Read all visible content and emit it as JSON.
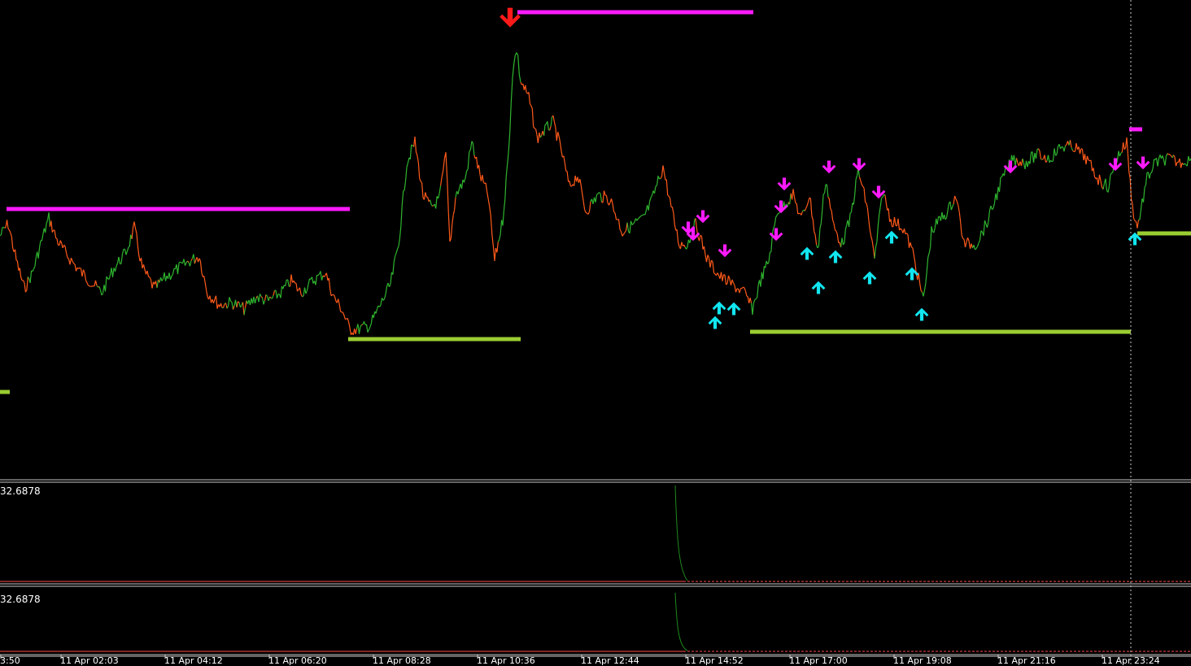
{
  "colors": {
    "background": "#000000",
    "up_series": "#2fb52f",
    "down_series": "#ff5a1a",
    "resistance": "#ff1aff",
    "support": "#9acd32",
    "sell_arrow": "#ff1aff",
    "buy_arrow": "#11e6f0",
    "major_sell_arrow": "#ff1a1a",
    "separator": "#c8c8c8",
    "indicator_line": "#1e8a1e",
    "indicator_level": "#ff4d4d",
    "crosshair": "#cccccc"
  },
  "panes": {
    "indicator1_value": "32.6878",
    "indicator2_value": "32.6878"
  },
  "x_axis": {
    "ticks": [
      "3:50",
      "11 Apr 02:03",
      "11 Apr 04:12",
      "11 Apr 06:20",
      "11 Apr 08:28",
      "11 Apr 10:36",
      "11 Apr 12:44",
      "11 Apr 14:52",
      "11 Apr 17:00",
      "11 Apr 19:08",
      "11 Apr 21:16",
      "11 Apr 23:24"
    ]
  },
  "chart_data": {
    "type": "line",
    "title": "",
    "x_unit": "minutes from first tick (11 Apr 00:00 approx)",
    "series": [
      {
        "name": "",
        "points": [
          [
            0,
            290
          ],
          [
            10,
            275
          ],
          [
            20,
            320
          ],
          [
            30,
            355
          ],
          [
            40,
            335
          ],
          [
            50,
            300
          ],
          [
            60,
            268
          ],
          [
            70,
            295
          ],
          [
            80,
            310
          ],
          [
            95,
            330
          ],
          [
            110,
            345
          ],
          [
            125,
            360
          ],
          [
            140,
            330
          ],
          [
            155,
            310
          ],
          [
            165,
            280
          ],
          [
            175,
            330
          ],
          [
            190,
            355
          ],
          [
            205,
            340
          ],
          [
            220,
            330
          ],
          [
            235,
            320
          ],
          [
            245,
            315
          ],
          [
            255,
            360
          ],
          [
            270,
            375
          ],
          [
            285,
            372
          ],
          [
            300,
            380
          ],
          [
            315,
            365
          ],
          [
            330,
            370
          ],
          [
            345,
            360
          ],
          [
            358,
            345
          ],
          [
            370,
            360
          ],
          [
            385,
            345
          ],
          [
            400,
            335
          ],
          [
            410,
            365
          ],
          [
            420,
            380
          ],
          [
            430,
            405
          ],
          [
            440,
            405
          ],
          [
            455,
            400
          ],
          [
            465,
            380
          ],
          [
            480,
            350
          ],
          [
            490,
            300
          ],
          [
            500,
            200
          ],
          [
            510,
            175
          ],
          [
            520,
            240
          ],
          [
            530,
            255
          ],
          [
            540,
            245
          ],
          [
            548,
            190
          ],
          [
            553,
            300
          ],
          [
            560,
            240
          ],
          [
            572,
            220
          ],
          [
            580,
            175
          ],
          [
            590,
            215
          ],
          [
            600,
            240
          ],
          [
            608,
            320
          ],
          [
            618,
            270
          ],
          [
            625,
            190
          ],
          [
            630,
            90
          ],
          [
            635,
            60
          ],
          [
            640,
            100
          ],
          [
            650,
            120
          ],
          [
            660,
            170
          ],
          [
            670,
            160
          ],
          [
            680,
            150
          ],
          [
            690,
            185
          ],
          [
            700,
            230
          ],
          [
            710,
            215
          ],
          [
            720,
            260
          ],
          [
            735,
            240
          ],
          [
            750,
            245
          ],
          [
            765,
            285
          ],
          [
            780,
            275
          ],
          [
            790,
            270
          ],
          [
            800,
            250
          ],
          [
            815,
            205
          ],
          [
            825,
            255
          ],
          [
            835,
            300
          ],
          [
            845,
            300
          ],
          [
            855,
            275
          ],
          [
            870,
            320
          ],
          [
            885,
            340
          ],
          [
            900,
            350
          ],
          [
            915,
            360
          ],
          [
            925,
            380
          ],
          [
            935,
            345
          ],
          [
            945,
            320
          ],
          [
            955,
            260
          ],
          [
            965,
            250
          ],
          [
            975,
            240
          ],
          [
            985,
            270
          ],
          [
            995,
            240
          ],
          [
            1005,
            310
          ],
          [
            1015,
            220
          ],
          [
            1025,
            280
          ],
          [
            1035,
            300
          ],
          [
            1045,
            270
          ],
          [
            1055,
            210
          ],
          [
            1065,
            250
          ],
          [
            1075,
            320
          ],
          [
            1085,
            235
          ],
          [
            1095,
            270
          ],
          [
            1110,
            280
          ],
          [
            1122,
            310
          ],
          [
            1135,
            370
          ],
          [
            1145,
            285
          ],
          [
            1155,
            270
          ],
          [
            1165,
            260
          ],
          [
            1175,
            240
          ],
          [
            1185,
            300
          ],
          [
            1200,
            300
          ],
          [
            1215,
            270
          ],
          [
            1230,
            225
          ],
          [
            1245,
            195
          ],
          [
            1260,
            200
          ],
          [
            1275,
            190
          ],
          [
            1290,
            195
          ],
          [
            1305,
            180
          ],
          [
            1320,
            180
          ],
          [
            1335,
            195
          ],
          [
            1350,
            220
          ],
          [
            1362,
            230
          ],
          [
            1375,
            190
          ],
          [
            1385,
            175
          ],
          [
            1392,
            255
          ],
          [
            1398,
            280
          ],
          [
            1410,
            220
          ],
          [
            1420,
            200
          ],
          [
            1435,
            195
          ],
          [
            1450,
            200
          ],
          [
            1464,
            195
          ]
        ]
      }
    ],
    "resistance_levels": [
      {
        "x_start": 8,
        "x_end": 430,
        "y": 257
      },
      {
        "x_start": 636,
        "x_end": 926,
        "y": 15
      },
      {
        "x_start": 1388,
        "x_end": 1404,
        "y": 159
      }
    ],
    "support_levels": [
      {
        "x_start": 0,
        "x_end": 12,
        "y": 482
      },
      {
        "x_start": 428,
        "x_end": 640,
        "y": 417
      },
      {
        "x_start": 922,
        "x_end": 1390,
        "y": 408
      },
      {
        "x_start": 1398,
        "x_end": 1464,
        "y": 287
      }
    ],
    "sell_signals": [
      {
        "x": 627,
        "y": 32,
        "major": true
      },
      {
        "x": 846,
        "y": 282
      },
      {
        "x": 852,
        "y": 290
      },
      {
        "x": 864,
        "y": 268
      },
      {
        "x": 891,
        "y": 310
      },
      {
        "x": 954,
        "y": 290
      },
      {
        "x": 960,
        "y": 256
      },
      {
        "x": 964,
        "y": 228
      },
      {
        "x": 1019,
        "y": 207
      },
      {
        "x": 1056,
        "y": 204
      },
      {
        "x": 1080,
        "y": 238
      },
      {
        "x": 1242,
        "y": 207
      },
      {
        "x": 1371,
        "y": 204
      },
      {
        "x": 1405,
        "y": 202
      }
    ],
    "buy_signals": [
      {
        "x": 879,
        "y": 395
      },
      {
        "x": 884,
        "y": 377
      },
      {
        "x": 902,
        "y": 378
      },
      {
        "x": 992,
        "y": 310
      },
      {
        "x": 1006,
        "y": 352
      },
      {
        "x": 1027,
        "y": 314
      },
      {
        "x": 1069,
        "y": 340
      },
      {
        "x": 1096,
        "y": 290
      },
      {
        "x": 1121,
        "y": 335
      },
      {
        "x": 1133,
        "y": 385
      },
      {
        "x": 1395,
        "y": 292
      }
    ],
    "crosshair_x": 1390,
    "panes": [
      {
        "name": "",
        "level": 32.6878
      },
      {
        "name": "",
        "level": 32.6878
      }
    ]
  }
}
